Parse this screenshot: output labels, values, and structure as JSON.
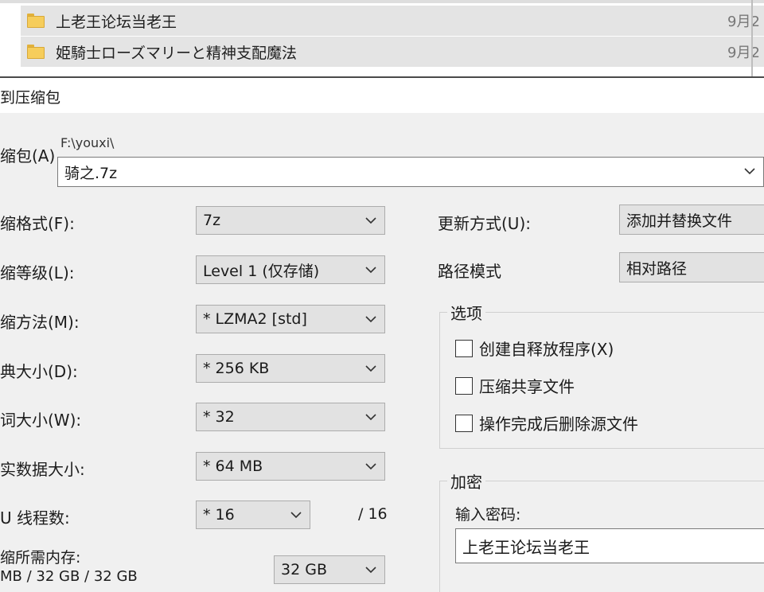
{
  "explorer": {
    "files": [
      {
        "name": "上老王论坛当老王",
        "date": "9月2"
      },
      {
        "name": "姫騎士ローズマリーと精神支配魔法",
        "date": "9月2"
      }
    ]
  },
  "dialog": {
    "title": "到压缩包",
    "archive": {
      "label": "缩包(A)",
      "path": "F:\\youxi\\",
      "value": "骑之.7z"
    },
    "format": {
      "label": "缩格式(F):",
      "value": "7z"
    },
    "level": {
      "label": "缩等级(L):",
      "value": "Level 1 (仅存储)"
    },
    "method": {
      "label": "缩方法(M):",
      "value": "* LZMA2 [std]"
    },
    "dict": {
      "label": "典大小(D):",
      "value": "* 256 KB"
    },
    "word": {
      "label": "词大小(W):",
      "value": "* 32"
    },
    "solid": {
      "label": "实数据大小:",
      "value": "* 64 MB"
    },
    "threads": {
      "label": "U 线程数:",
      "value": "* 16",
      "max": "/ 16"
    },
    "memory": {
      "label": "缩所需内存:",
      "detail": "MB / 32 GB / 32 GB",
      "value": "32 GB"
    },
    "update_mode": {
      "label": "更新方式(U):",
      "value": "添加并替换文件"
    },
    "path_mode": {
      "label": "路径模式",
      "value": "相对路径"
    },
    "options": {
      "title": "选项",
      "items": [
        {
          "label": "创建自释放程序(X)",
          "checked": false
        },
        {
          "label": "压缩共享文件",
          "checked": false
        },
        {
          "label": "操作完成后删除源文件",
          "checked": false
        }
      ]
    },
    "encryption": {
      "title": "加密",
      "password_label": "输入密码:",
      "password_value": "上老王论坛当老王"
    }
  }
}
